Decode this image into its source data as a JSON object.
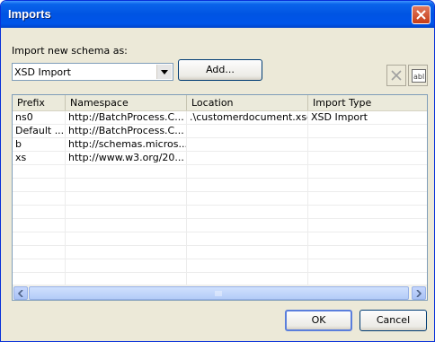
{
  "window": {
    "title": "Imports"
  },
  "form": {
    "schema_label": "Import new schema as:",
    "schema_select_value": "XSD Import",
    "add_button": "Add...",
    "ok_button": "OK",
    "cancel_button": "Cancel"
  },
  "table": {
    "columns": [
      "Prefix",
      "Namespace",
      "Location",
      "Import Type"
    ],
    "rows": [
      [
        "ns0",
        "http://BatchProcess.C...",
        ".\\customerdocument.xsd",
        "XSD Import"
      ],
      [
        "Default ...",
        "http://BatchProcess.C...",
        "",
        ""
      ],
      [
        "b",
        "http://schemas.micros...",
        "",
        ""
      ],
      [
        "xs",
        "http://www.w3.org/20...",
        "",
        ""
      ]
    ]
  },
  "colors": {
    "title_bar": "#0054e3",
    "close_button": "#c63c17",
    "dialog_background": "#ece9d8",
    "scrollbar": "#b4ccf8"
  },
  "icons": {
    "close": "close-icon",
    "delete": "delete-x-icon",
    "rename": "rename-abl-icon",
    "dropdown": "chevron-down-icon"
  }
}
